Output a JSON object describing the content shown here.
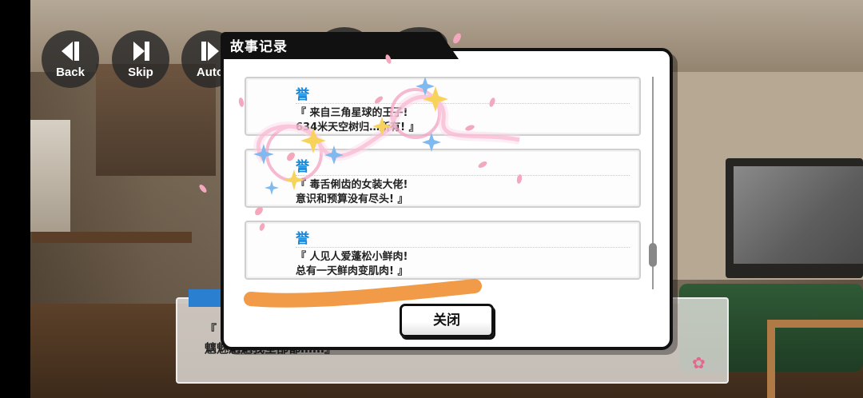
{
  "controls": {
    "back_label": "Back",
    "skip_label": "Skip",
    "auto_label": "Auto"
  },
  "story_log": {
    "title": "故事记录",
    "entries": [
      {
        "speaker": "誉",
        "line1": "『 来自三角星球的王子!",
        "line2": "634米天空树归…所有! 』"
      },
      {
        "speaker": "誉",
        "line1": "『 毒舌俐齿的女装大佬!",
        "line2": "意识和预算没有尽头! 』"
      },
      {
        "speaker": "誉",
        "line1": "『 人见人爱蓬松小鲜肉!",
        "line2": "总有一天鲜肉变肌肉! 』"
      }
    ],
    "scroll_position": 0.88,
    "close_label": "关闭"
  },
  "dialogue_backdrop": {
    "text_line1": "『",
    "text_line2": "魑魅魍魉我全部都……』"
  },
  "colors": {
    "speaker_name": "#1a86d6",
    "popup_border": "#111111",
    "highlight_stroke": "#f0923a",
    "sparkle_pink": "#f5a3c3",
    "sparkle_blue": "#7fb9f0",
    "sparkle_gold": "#f7d35c"
  }
}
